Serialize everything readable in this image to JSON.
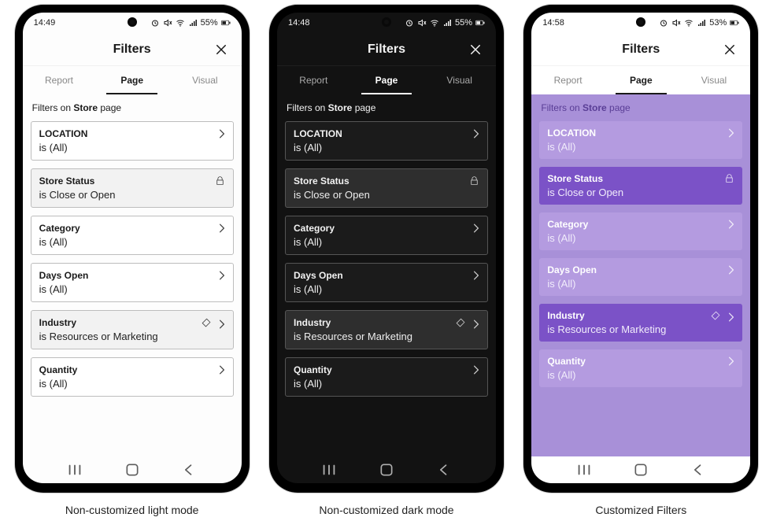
{
  "phones": [
    {
      "id": "light",
      "themeClass": "light",
      "statusbar": {
        "time": "14:49",
        "battery": "55%"
      },
      "title": "Filters",
      "tabs": [
        "Report",
        "Page",
        "Visual"
      ],
      "activeTab": 1,
      "sectionPrefix": "Filters on ",
      "sectionBold": "Store",
      "sectionSuffix": " page",
      "cards": [
        {
          "title": "LOCATION",
          "value": "is (All)",
          "applied": false,
          "locked": false,
          "clearable": false
        },
        {
          "title": "Store Status",
          "value": "is Close or Open",
          "applied": true,
          "locked": true,
          "clearable": false
        },
        {
          "title": "Category",
          "value": "is (All)",
          "applied": false,
          "locked": false,
          "clearable": false
        },
        {
          "title": "Days Open",
          "value": "is (All)",
          "applied": false,
          "locked": false,
          "clearable": false
        },
        {
          "title": "Industry",
          "value": "is Resources or Marketing",
          "applied": true,
          "locked": false,
          "clearable": true
        },
        {
          "title": "Quantity",
          "value": "is (All)",
          "applied": false,
          "locked": false,
          "clearable": false
        }
      ],
      "caption": "Non-customized light mode"
    },
    {
      "id": "dark",
      "themeClass": "dark",
      "statusbar": {
        "time": "14:48",
        "battery": "55%"
      },
      "title": "Filters",
      "tabs": [
        "Report",
        "Page",
        "Visual"
      ],
      "activeTab": 1,
      "sectionPrefix": "Filters on ",
      "sectionBold": "Store",
      "sectionSuffix": " page",
      "cards": [
        {
          "title": "LOCATION",
          "value": "is (All)",
          "applied": false,
          "locked": false,
          "clearable": false
        },
        {
          "title": "Store Status",
          "value": "is Close or Open",
          "applied": true,
          "locked": true,
          "clearable": false
        },
        {
          "title": "Category",
          "value": "is (All)",
          "applied": false,
          "locked": false,
          "clearable": false
        },
        {
          "title": "Days Open",
          "value": "is (All)",
          "applied": false,
          "locked": false,
          "clearable": false
        },
        {
          "title": "Industry",
          "value": "is Resources or Marketing",
          "applied": true,
          "locked": false,
          "clearable": true
        },
        {
          "title": "Quantity",
          "value": "is (All)",
          "applied": false,
          "locked": false,
          "clearable": false
        }
      ],
      "caption": "Non-customized dark mode"
    },
    {
      "id": "custom",
      "themeClass": "custom",
      "statusbar": {
        "time": "14:58",
        "battery": "53%"
      },
      "title": "Filters",
      "tabs": [
        "Report",
        "Page",
        "Visual"
      ],
      "activeTab": 1,
      "sectionPrefix": "Filters on ",
      "sectionBold": "Store",
      "sectionSuffix": " page",
      "cards": [
        {
          "title": "LOCATION",
          "value": "is (All)",
          "applied": false,
          "locked": false,
          "clearable": false
        },
        {
          "title": "Store Status",
          "value": "is Close or Open",
          "applied": true,
          "locked": true,
          "clearable": false
        },
        {
          "title": "Category",
          "value": "is (All)",
          "applied": false,
          "locked": false,
          "clearable": false
        },
        {
          "title": "Days Open",
          "value": "is (All)",
          "applied": false,
          "locked": false,
          "clearable": false
        },
        {
          "title": "Industry",
          "value": "is Resources or Marketing",
          "applied": true,
          "locked": false,
          "clearable": true
        },
        {
          "title": "Quantity",
          "value": "is (All)",
          "applied": false,
          "locked": false,
          "clearable": false
        }
      ],
      "caption": "Customized Filters"
    }
  ],
  "icons": {
    "close": "close-icon",
    "lock": "lock-icon",
    "eraser": "eraser-icon",
    "chevron": "chevron-right-icon"
  }
}
